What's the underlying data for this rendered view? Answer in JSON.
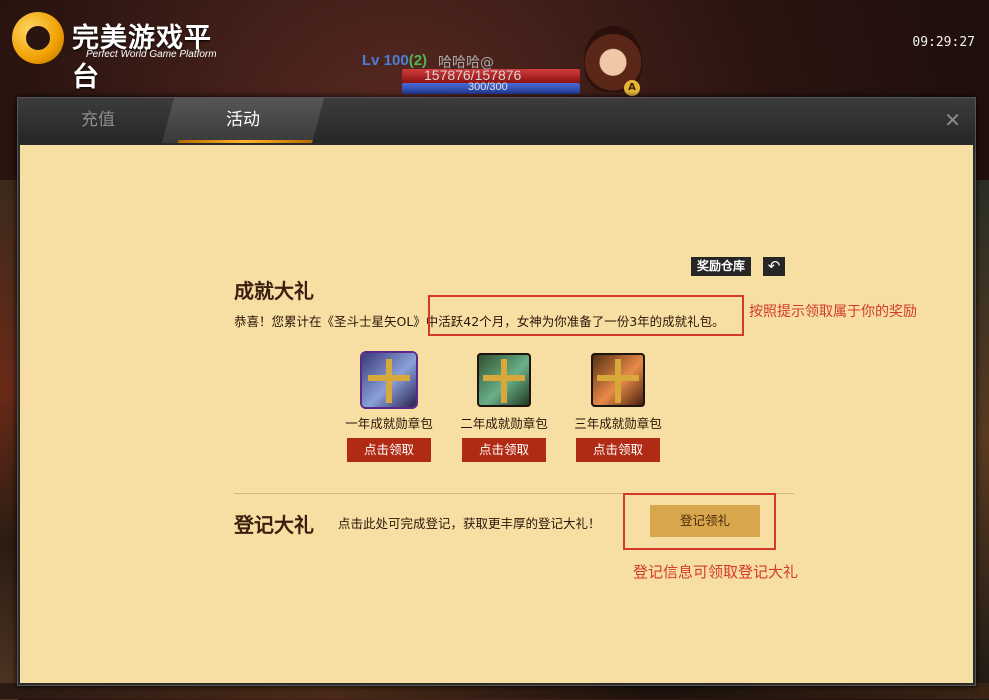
{
  "platform": {
    "title": "完美游戏平台",
    "subtitle": "Perfect World Game Platform"
  },
  "clock": "09:29:27",
  "player": {
    "level": "Lv 100",
    "level_up": "(2)",
    "name": "哈哈哈@",
    "hp": "157876/157876",
    "mp": "300/300"
  },
  "tabs": [
    {
      "label": "充值",
      "active": false
    },
    {
      "label": "活动",
      "active": true
    }
  ],
  "toolbar": {
    "warehouse_label": "奖励仓库",
    "back_icon": "↶"
  },
  "achievement": {
    "title": "成就大礼",
    "congrats": "恭喜！您累计在《圣斗士星矢OL》中活跃42个月，女神为你准备了一份3年的成就礼包。",
    "annotation": "按照提示领取属于你的奖励",
    "gifts": [
      {
        "name": "一年成就勋章包",
        "button": "点击领取",
        "icon": "gift-box-blue-icon"
      },
      {
        "name": "二年成就勋章包",
        "button": "点击领取",
        "icon": "gift-box-green-icon"
      },
      {
        "name": "三年成就勋章包",
        "button": "点击领取",
        "icon": "gift-box-orange-icon"
      }
    ]
  },
  "registration": {
    "title": "登记大礼",
    "description": "点击此处可完成登记，获取更丰厚的登记大礼！",
    "button": "登记领礼",
    "annotation": "登记信息可领取登记大礼"
  },
  "colors": {
    "panel_bg": "#f7dfa4",
    "claim_button": "#b02a14",
    "annotation_red": "#d43a2a",
    "register_button": "#d8a74d"
  }
}
